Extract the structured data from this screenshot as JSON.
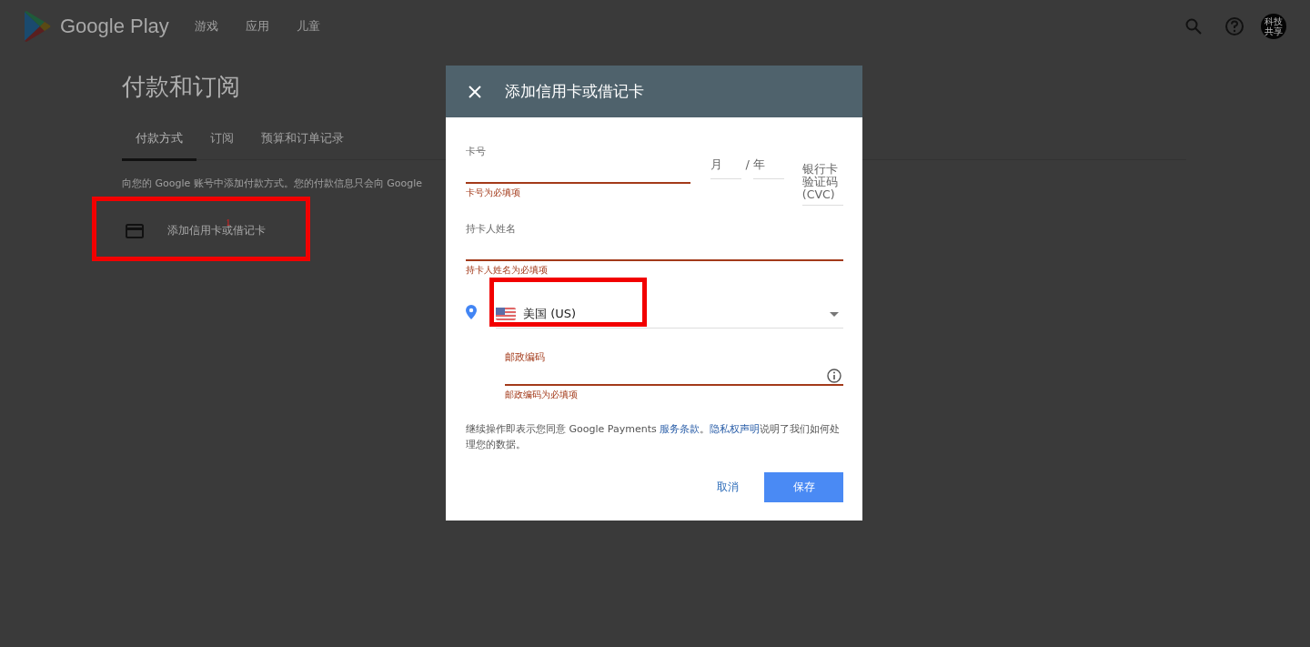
{
  "header": {
    "brand": "Google Play",
    "nav": [
      "游戏",
      "应用",
      "儿童"
    ],
    "avatar_text": "科技共享"
  },
  "page": {
    "title": "付款和订阅",
    "tabs": [
      {
        "label": "付款方式",
        "selected": true
      },
      {
        "label": "订阅",
        "selected": false
      },
      {
        "label": "预算和订单记录",
        "selected": false
      }
    ],
    "description": "向您的 Google 账号中添加付款方式。您的付款信息只会向 Google",
    "add_card": "添加信用卡或借记卡"
  },
  "dialog": {
    "title": "添加信用卡或借记卡",
    "card_number": {
      "label": "卡号",
      "error": "卡号为必填项"
    },
    "month": {
      "placeholder": "月"
    },
    "separator": "/",
    "year": {
      "placeholder": "年"
    },
    "cvc": {
      "placeholder": "银行卡验证码(CVC)"
    },
    "cardholder": {
      "label": "持卡人姓名",
      "error": "持卡人姓名为必填项"
    },
    "country": {
      "value": "美国 (US)"
    },
    "postal": {
      "label": "邮政编码",
      "error": "邮政编码为必填项"
    },
    "terms": {
      "before": "继续操作即表示您同意 Google Payments ",
      "link_1": "服务条款",
      "middle": "。",
      "link_2": "隐私权声明",
      "after": "说明了我们如何处理您的数据。"
    },
    "buttons": {
      "cancel": "取消",
      "save": "保存"
    }
  },
  "annotation": {
    "number": "1"
  }
}
